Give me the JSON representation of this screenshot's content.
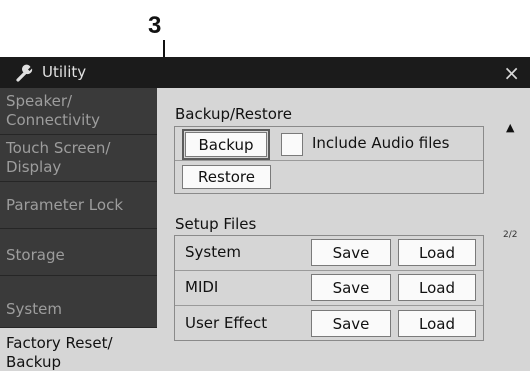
{
  "callout": {
    "number": "3"
  },
  "window": {
    "title": "Utility",
    "close_glyph": "×",
    "title_icon": "wrench-icon"
  },
  "sidebar": {
    "items": [
      {
        "label_line1": "Speaker/",
        "label_line2": "Connectivity",
        "active": false
      },
      {
        "label_line1": "Touch Screen/",
        "label_line2": "Display",
        "active": false
      },
      {
        "label_line1": "Parameter Lock",
        "label_line2": "",
        "active": false
      },
      {
        "label_line1": "Storage",
        "label_line2": "",
        "active": false
      },
      {
        "label_line1": "System",
        "label_line2": "",
        "active": false
      },
      {
        "label_line1": "Factory Reset/",
        "label_line2": "Backup",
        "active": true
      }
    ]
  },
  "backup_restore": {
    "title": "Backup/Restore",
    "backup_label": "Backup",
    "include_audio_label": "Include Audio files",
    "include_audio_checked": false,
    "restore_label": "Restore"
  },
  "setup_files": {
    "title": "Setup Files",
    "rows": [
      {
        "label": "System",
        "save": "Save",
        "load": "Load"
      },
      {
        "label": "MIDI",
        "save": "Save",
        "load": "Load"
      },
      {
        "label": "User Effect",
        "save": "Save",
        "load": "Load"
      }
    ]
  },
  "pager": {
    "up_glyph": "▲",
    "page": "2/2"
  }
}
